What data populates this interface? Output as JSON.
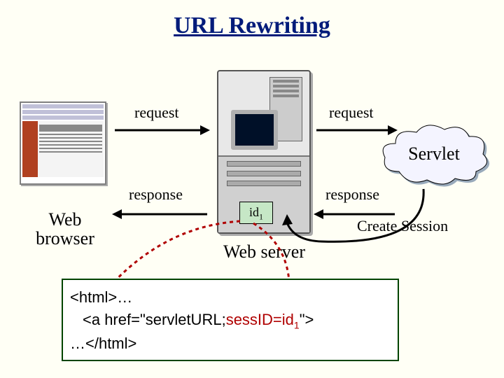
{
  "title": "URL Rewriting",
  "browser_label_l1": "Web",
  "browser_label_l2": "browser",
  "server_label": "Web server",
  "servlet_label": "Servlet",
  "create_session_label": "Create Session",
  "arrows": {
    "req_left": "request",
    "req_right": "request",
    "resp_left": "response",
    "resp_right": "response"
  },
  "id_badge_prefix": "id",
  "id_badge_sub": "1",
  "code": {
    "line1": "<html>…",
    "line2_pre": "<a href=\"servletURL;",
    "line2_sess_a": "sessID=id",
    "line2_sess_sub": "1",
    "line2_post": "\">",
    "line3": "…</html>"
  }
}
